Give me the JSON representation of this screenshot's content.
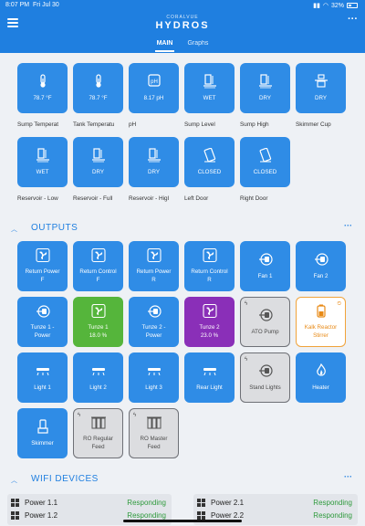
{
  "status_bar": {
    "time": "8:07 PM",
    "date": "Fri Jul 30",
    "battery": "32%"
  },
  "app": {
    "brand_top": "CORALVUE",
    "brand_main": "HYDROS",
    "tabs": [
      {
        "label": "MAIN",
        "active": true
      },
      {
        "label": "Graphs",
        "active": false
      }
    ]
  },
  "inputs": {
    "row1": [
      {
        "value": "78.7 °F",
        "icon": "thermometer-icon",
        "label": "Sump Temperat"
      },
      {
        "value": "78.7 °F",
        "icon": "thermometer-icon",
        "label": "Tank Temperatu"
      },
      {
        "value": "8.17 pH",
        "icon": "ph-icon",
        "label": "pH"
      },
      {
        "value": "WET",
        "icon": "water-sensor-icon",
        "label": "Sump Level"
      },
      {
        "value": "DRY",
        "icon": "water-sensor-icon",
        "label": "Sump High"
      },
      {
        "value": "DRY",
        "icon": "skimmer-cup-icon",
        "label": "Skimmer Cup"
      }
    ],
    "row2": [
      {
        "value": "WET",
        "icon": "water-sensor-icon",
        "label": "Reservoir - Low"
      },
      {
        "value": "DRY",
        "icon": "water-sensor-icon",
        "label": "Reservoir - Full"
      },
      {
        "value": "DRY",
        "icon": "water-sensor-icon",
        "label": "Reservoir - Higl"
      },
      {
        "value": "CLOSED",
        "icon": "door-icon",
        "label": "Left Door"
      },
      {
        "value": "CLOSED",
        "icon": "door-icon",
        "label": "Right Door"
      }
    ]
  },
  "outputs": {
    "title": "OUTPUTS",
    "rows": [
      [
        {
          "name": "Return Power",
          "sub": "F",
          "icon": "fan-icon",
          "style": "blue"
        },
        {
          "name": "Return Control",
          "sub": "F",
          "icon": "fan-icon",
          "style": "blue"
        },
        {
          "name": "Return Power",
          "sub": "R",
          "icon": "fan-icon",
          "style": "blue"
        },
        {
          "name": "Return Control",
          "sub": "R",
          "icon": "fan-icon",
          "style": "blue"
        },
        {
          "name": "Fan 1",
          "sub": "",
          "icon": "plug-icon",
          "style": "blue"
        },
        {
          "name": "Fan 2",
          "sub": "",
          "icon": "plug-icon",
          "style": "blue"
        }
      ],
      [
        {
          "name": "Tunze 1 -",
          "sub": "Power",
          "icon": "plug-icon",
          "style": "blue"
        },
        {
          "name": "Tunze 1",
          "sub": "18.0 %",
          "icon": "fan-icon",
          "style": "green"
        },
        {
          "name": "Tunze 2 -",
          "sub": "Power",
          "icon": "plug-icon",
          "style": "blue"
        },
        {
          "name": "Tunze 2",
          "sub": "23.0 %",
          "icon": "fan-icon",
          "style": "purple"
        },
        {
          "name": "ATO Pump",
          "sub": "",
          "icon": "plug-icon",
          "style": "grey"
        },
        {
          "name": "Kalk Reactor",
          "sub": "Stirrer",
          "icon": "reactor-icon",
          "style": "orange"
        }
      ],
      [
        {
          "name": "Light 1",
          "sub": "",
          "icon": "light-icon",
          "style": "blue"
        },
        {
          "name": "Light 2",
          "sub": "",
          "icon": "light-icon",
          "style": "blue"
        },
        {
          "name": "Light 3",
          "sub": "",
          "icon": "light-icon",
          "style": "blue"
        },
        {
          "name": "Rear Light",
          "sub": "",
          "icon": "light-icon",
          "style": "blue"
        },
        {
          "name": "Stand Lights",
          "sub": "",
          "icon": "plug-icon",
          "style": "grey"
        },
        {
          "name": "Heater",
          "sub": "",
          "icon": "flame-icon",
          "style": "blue"
        }
      ],
      [
        {
          "name": "Skimmer",
          "sub": "",
          "icon": "skimmer-icon",
          "style": "blue"
        },
        {
          "name": "RO Regular",
          "sub": "Feed",
          "icon": "ro-filter-icon",
          "style": "grey"
        },
        {
          "name": "RO Master",
          "sub": "Feed",
          "icon": "ro-filter-icon",
          "style": "grey"
        }
      ]
    ]
  },
  "wifi": {
    "title": "WIFI DEVICES",
    "cards": [
      {
        "lines": [
          {
            "name": "Power 1.1",
            "status": "Responding"
          },
          {
            "name": "Power 1.2",
            "status": "Responding"
          }
        ]
      },
      {
        "lines": [
          {
            "name": "Power 2.1",
            "status": "Responding"
          },
          {
            "name": "Power 2.2",
            "status": "Responding"
          }
        ]
      }
    ]
  },
  "colors": {
    "accent": "#1f7fe0",
    "tile": "#2f8ce6",
    "green": "#55b53b",
    "purple": "#8a2fb8",
    "orange": "#f0a33a",
    "responding": "#2e9a3c"
  }
}
